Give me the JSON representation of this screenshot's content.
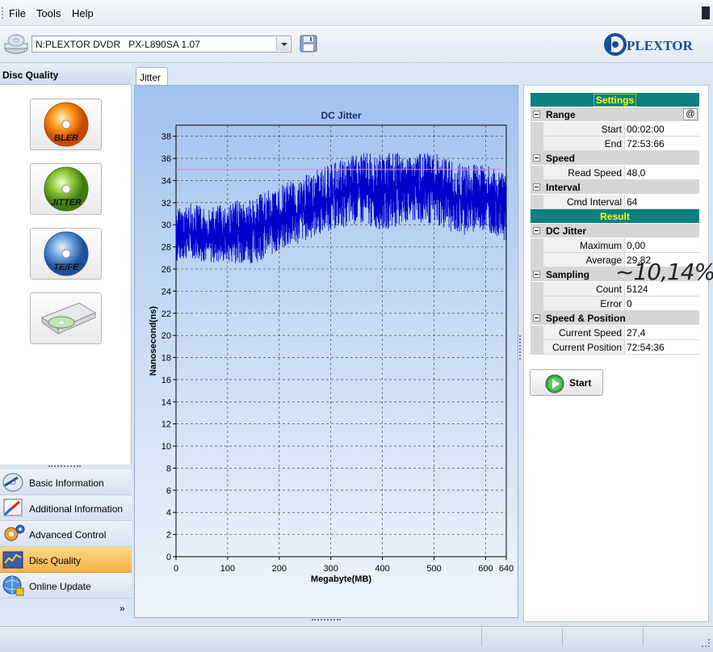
{
  "menu": {
    "items": [
      "File",
      "Tools",
      "Help"
    ]
  },
  "toolbar": {
    "drive": "N:PLEXTOR DVDR   PX-L890SA 1.07",
    "logo_text": "PLEXTOR"
  },
  "left_panel": {
    "title": "Disc Quality",
    "buttons": [
      {
        "label": "BLER",
        "icon": "bler-disc-icon"
      },
      {
        "label": "JITTER",
        "icon": "jitter-disc-icon"
      },
      {
        "label": "TE/FE",
        "icon": "tefe-disc-icon"
      },
      {
        "label": "",
        "icon": "drive-tray-icon"
      }
    ],
    "nav": [
      {
        "label": "Basic Information",
        "icon": "basic-information-icon",
        "active": false
      },
      {
        "label": "Additional Information",
        "icon": "additional-information-icon",
        "active": false
      },
      {
        "label": "Advanced Control",
        "icon": "advanced-control-icon",
        "active": false
      },
      {
        "label": "Disc Quality",
        "icon": "disc-quality-icon",
        "active": true
      },
      {
        "label": "Online Update",
        "icon": "online-update-icon",
        "active": false
      }
    ],
    "more": "»"
  },
  "tabs": [
    {
      "label": "Jitter",
      "active": true
    }
  ],
  "chart_data": {
    "type": "line",
    "title": "DC Jitter",
    "xlabel": "Megabyte(MB)",
    "ylabel": "Nanosecond(ns)",
    "xlim": [
      0,
      640
    ],
    "ylim": [
      0,
      39
    ],
    "xticks": [
      0,
      100,
      200,
      300,
      400,
      500,
      600,
      640
    ],
    "yticks": [
      0,
      2,
      4,
      6,
      8,
      10,
      12,
      14,
      16,
      18,
      20,
      22,
      24,
      26,
      28,
      30,
      32,
      34,
      36,
      38
    ],
    "grid": true,
    "threshold": {
      "y": 35,
      "x_start": 0,
      "x_end": 640,
      "color": "#e080e0"
    },
    "series": [
      {
        "color": "#0000cc",
        "band_x": [
          0,
          30,
          60,
          100,
          150,
          200,
          250,
          300,
          350,
          400,
          450,
          500,
          550,
          600,
          640
        ],
        "band_low": [
          26.5,
          27.0,
          26.5,
          26.5,
          26.5,
          27.5,
          28.5,
          29.5,
          30.0,
          29.5,
          30.0,
          30.0,
          29.0,
          29.5,
          28.5
        ],
        "band_high": [
          31.5,
          32.0,
          31.5,
          32.0,
          32.5,
          33.5,
          34.5,
          35.5,
          36.5,
          36.5,
          36.5,
          36.5,
          35.5,
          35.5,
          34.5
        ]
      }
    ]
  },
  "settings": {
    "header": "Settings",
    "range": {
      "label": "Range",
      "button": "@",
      "start_label": "Start",
      "start": "00:02:00",
      "end_label": "End",
      "end": "72:53:66"
    },
    "speed": {
      "label": "Speed",
      "read_speed_label": "Read Speed",
      "read_speed": "48,0"
    },
    "interval": {
      "label": "Interval",
      "cmd_label": "Cmd Interval",
      "cmd": "64"
    }
  },
  "result": {
    "header": "Result",
    "dc_jitter": {
      "label": "DC Jitter",
      "max_label": "Maximum",
      "max": "0,00",
      "avg_label": "Average",
      "avg": "29,82"
    },
    "sampling": {
      "label": "Sampling",
      "count_label": "Count",
      "count": "5124",
      "error_label": "Error",
      "error": "0"
    },
    "speed_position": {
      "label": "Speed & Position",
      "speed_label": "Current Speed",
      "speed": "27,4",
      "pos_label": "Current Position",
      "pos": "72:54:36"
    }
  },
  "overlay_text": "~10,14%",
  "start_button": "Start"
}
